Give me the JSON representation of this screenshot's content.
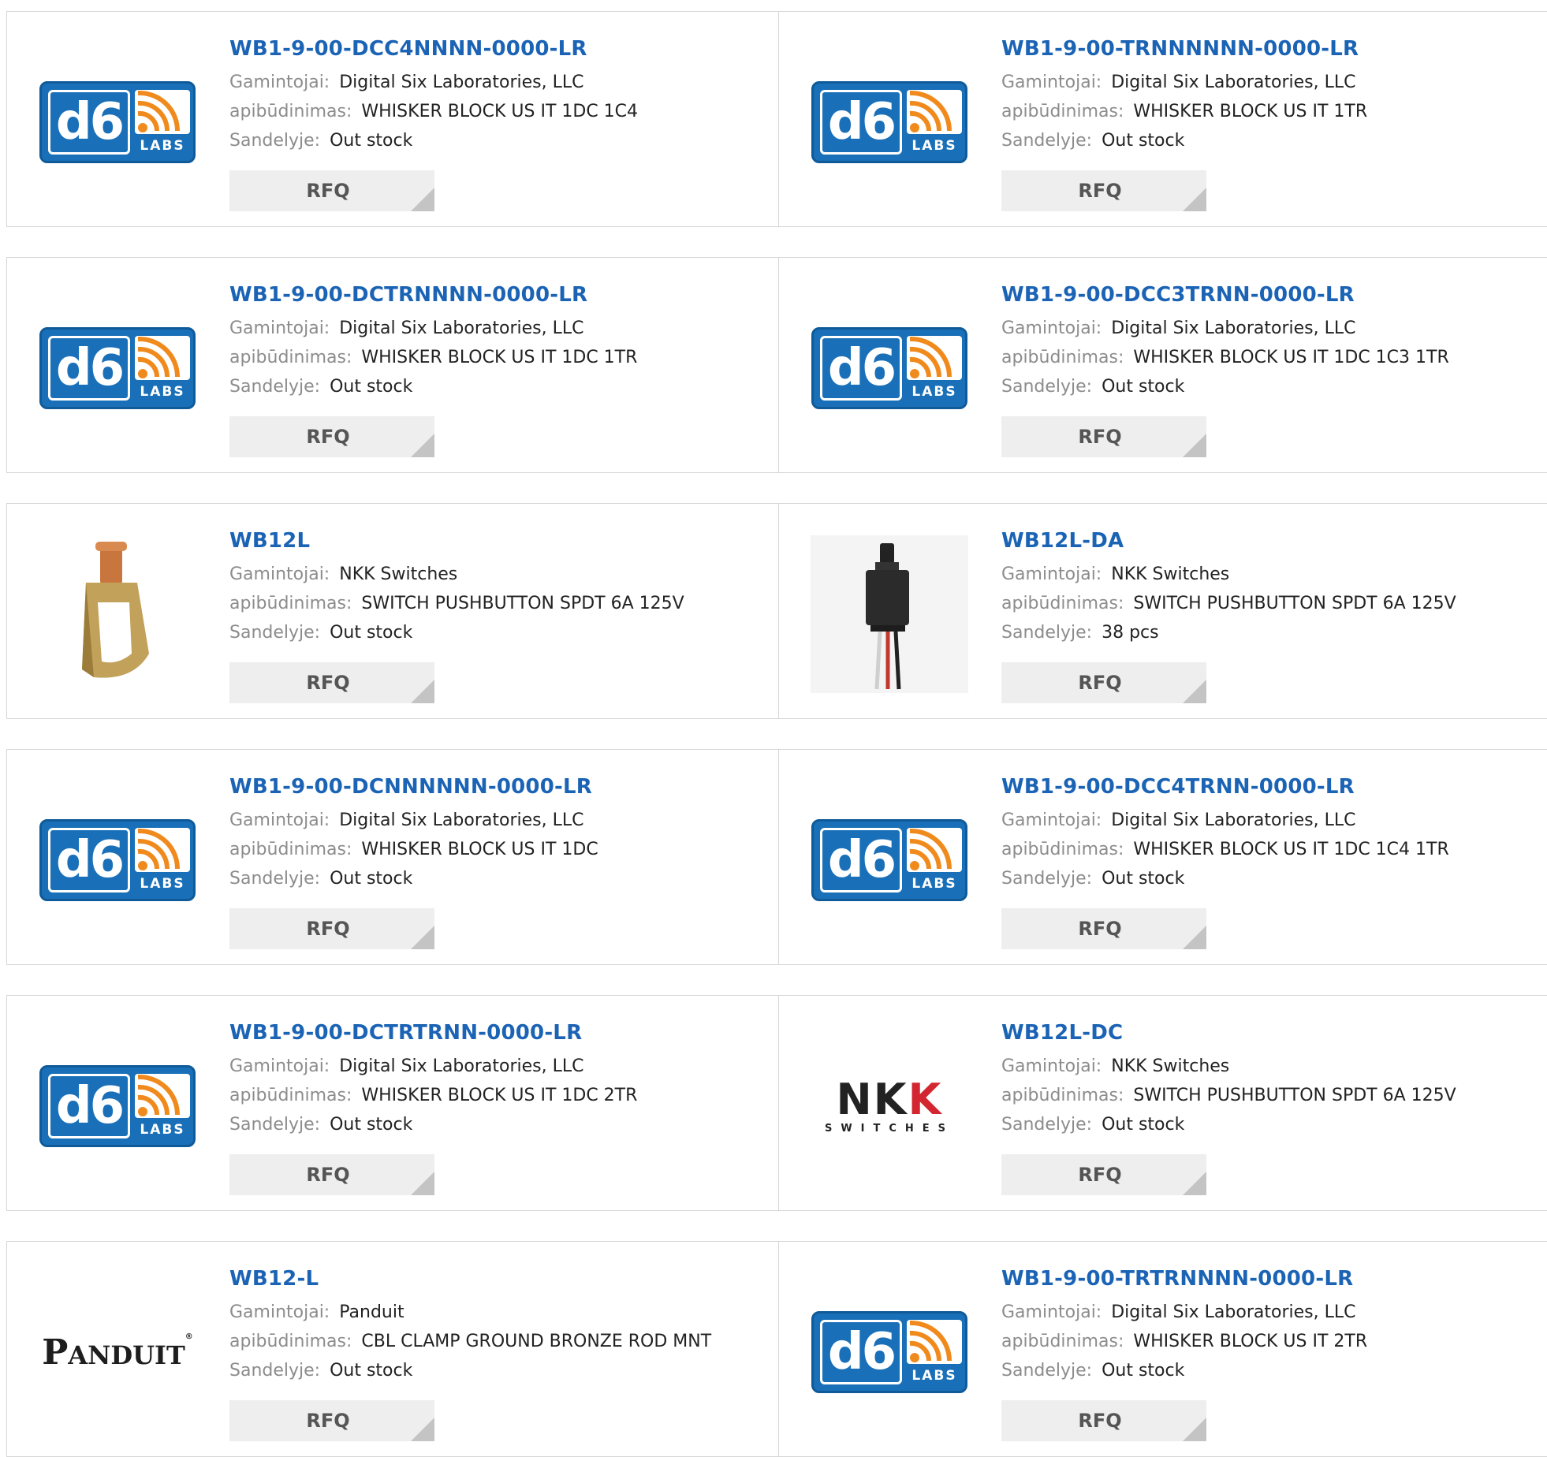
{
  "labels": {
    "manufacturer": "Gamintojai:",
    "description": "apibūdinimas:",
    "stock": "Sandelyje:",
    "rfq": "RFQ"
  },
  "products": [
    {
      "part": "WB1-9-00-DCC4NNNN-0000-LR",
      "manufacturer": "Digital Six Laboratories, LLC",
      "description": "WHISKER BLOCK US IT 1DC 1C4",
      "stock": "Out stock",
      "image": "d6-labs-logo"
    },
    {
      "part": "WB1-9-00-TRNNNNNN-0000-LR",
      "manufacturer": "Digital Six Laboratories, LLC",
      "description": "WHISKER BLOCK US IT 1TR",
      "stock": "Out stock",
      "image": "d6-labs-logo"
    },
    {
      "part": "WB1-9-00-DCTRNNNN-0000-LR",
      "manufacturer": "Digital Six Laboratories, LLC",
      "description": "WHISKER BLOCK US IT 1DC 1TR",
      "stock": "Out stock",
      "image": "d6-labs-logo"
    },
    {
      "part": "WB1-9-00-DCC3TRNN-0000-LR",
      "manufacturer": "Digital Six Laboratories, LLC",
      "description": "WHISKER BLOCK US IT 1DC 1C3 1TR",
      "stock": "Out stock",
      "image": "d6-labs-logo"
    },
    {
      "part": "WB12L",
      "manufacturer": "NKK Switches",
      "description": "SWITCH PUSHBUTTON SPDT 6A 125V",
      "stock": "Out stock",
      "image": "bronze-clamp-photo"
    },
    {
      "part": "WB12L-DA",
      "manufacturer": "NKK Switches",
      "description": "SWITCH PUSHBUTTON SPDT 6A 125V",
      "stock": "38 pcs",
      "image": "pushbutton-switch-photo"
    },
    {
      "part": "WB1-9-00-DCNNNNNN-0000-LR",
      "manufacturer": "Digital Six Laboratories, LLC",
      "description": "WHISKER BLOCK US IT 1DC",
      "stock": "Out stock",
      "image": "d6-labs-logo"
    },
    {
      "part": "WB1-9-00-DCC4TRNN-0000-LR",
      "manufacturer": "Digital Six Laboratories, LLC",
      "description": "WHISKER BLOCK US IT 1DC 1C4 1TR",
      "stock": "Out stock",
      "image": "d6-labs-logo"
    },
    {
      "part": "WB1-9-00-DCTRTRNN-0000-LR",
      "manufacturer": "Digital Six Laboratories, LLC",
      "description": "WHISKER BLOCK US IT 1DC 2TR",
      "stock": "Out stock",
      "image": "d6-labs-logo"
    },
    {
      "part": "WB12L-DC",
      "manufacturer": "NKK Switches",
      "description": "SWITCH PUSHBUTTON SPDT 6A 125V",
      "stock": "Out stock",
      "image": "nkk-switches-logo"
    },
    {
      "part": "WB12-L",
      "manufacturer": "Panduit",
      "description": "CBL CLAMP GROUND BRONZE ROD MNT",
      "stock": "Out stock",
      "image": "panduit-logo"
    },
    {
      "part": "WB1-9-00-TRTRNNNN-0000-LR",
      "manufacturer": "Digital Six Laboratories, LLC",
      "description": "WHISKER BLOCK US IT 2TR",
      "stock": "Out stock",
      "image": "d6-labs-logo"
    }
  ],
  "logos": {
    "d6_main": "d6",
    "d6_sub": "LABS",
    "nkk_black": "NK",
    "nkk_red": "K",
    "nkk_sub": "SWITCHES",
    "panduit_initial": "P",
    "panduit_rest": "ANDUIT",
    "panduit_mark": "®"
  },
  "colors": {
    "link": "#1b63b5",
    "label": "#8c8c8c",
    "value": "#222222",
    "rfq_bg": "#eeeeee",
    "border": "#d6d6d6",
    "d6_blue": "#1a70b8",
    "d6_orange": "#f08a1c",
    "nkk_red": "#d22630"
  }
}
